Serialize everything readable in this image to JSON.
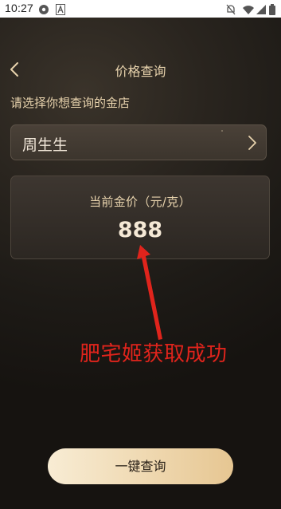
{
  "status_bar": {
    "time": "10:27",
    "icons": [
      "settings-gear-icon",
      "letter-a-icon",
      "notification-off-icon",
      "wifi-icon",
      "signal-icon",
      "battery-icon"
    ]
  },
  "navbar": {
    "title": "价格查询",
    "back_icon": "chevron-left-icon"
  },
  "prompt": "请选择你想查询的金店",
  "store_select": {
    "selected": "周生生",
    "icon": "chevron-right-icon"
  },
  "price_card": {
    "label": "当前金价（元/克）",
    "value": "888"
  },
  "annotation": {
    "text": "肥宅姬获取成功",
    "color": "#e0241c"
  },
  "action": {
    "query_label": "一键查询"
  },
  "colors": {
    "accent_gold": "#e8d3ad",
    "background_dark": "#1c1915",
    "button_gold": "#efd8b0"
  }
}
